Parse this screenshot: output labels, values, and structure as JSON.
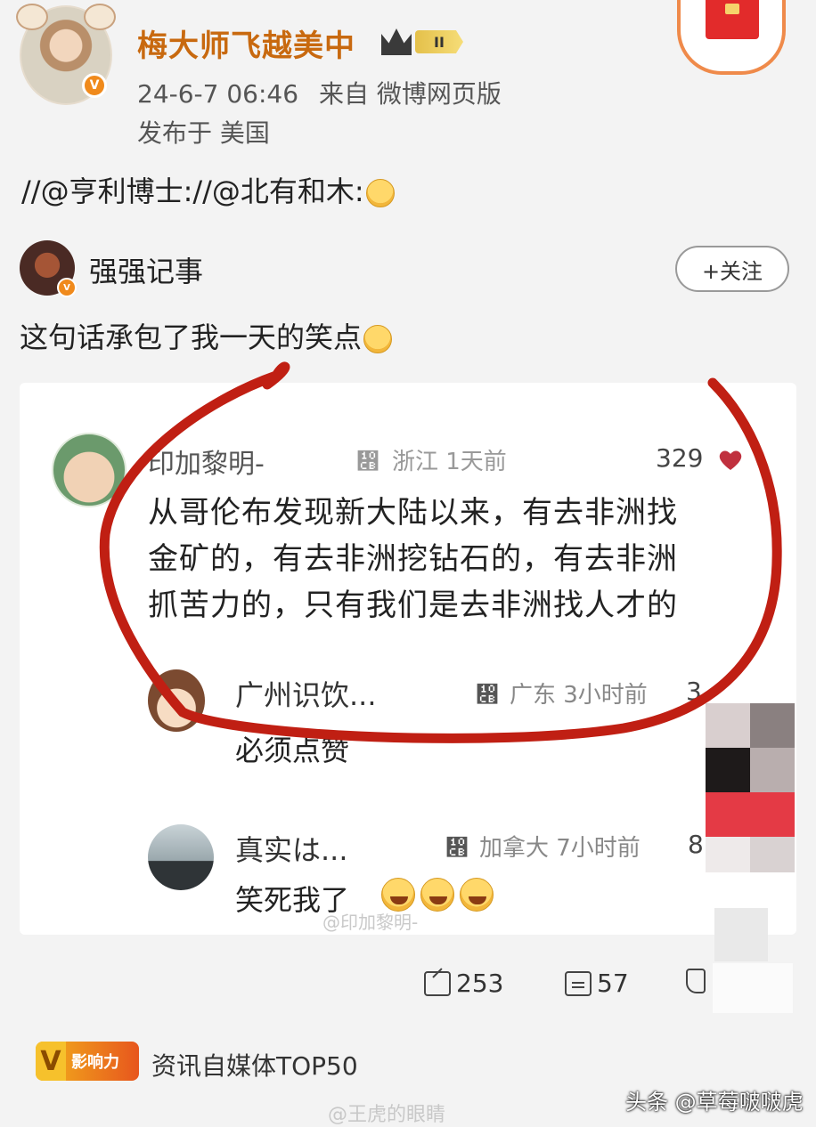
{
  "post": {
    "author_name": "梅大师飞越美中",
    "level": "II",
    "timestamp": "24-6-7 06:46",
    "source": "来自 微博网页版",
    "location": "发布于 美国",
    "repost_chain": "//@亨利博士://@北有和木:"
  },
  "quoted": {
    "author_name": "强强记事",
    "follow_label": "+关注",
    "text": "这句话承包了我一天的笑点"
  },
  "comments": [
    {
      "name": "印加黎明-",
      "location": "浙江 1天前",
      "likes": "329",
      "lines": [
        "从哥伦布发现新大陆以来，有去非洲找",
        "金矿的，有去非洲挖钻石的，有去非洲",
        "抓苦力的，只有我们是去非洲找人才的"
      ]
    },
    {
      "name": "广州识饮...",
      "location": "广东 3小时前",
      "likes": "3",
      "text": "必须点赞"
    },
    {
      "name": "真实は...",
      "location": "加拿大 7小时前",
      "likes": "8",
      "text": "笑死我了"
    }
  ],
  "actions": {
    "reposts": "253",
    "comments": "57"
  },
  "footer": {
    "badge_label": "影响力",
    "badge_letter": "V",
    "influence_text": "资讯自媒体TOP50",
    "watermark_card": "@印加黎明-",
    "watermark_bottom": "@王虎的眼睛",
    "toutiao": "头条 @草莓啵啵虎"
  },
  "colors": {
    "author": "#c8690f",
    "circle": "#c01f13",
    "heart": "#c0303e"
  },
  "icons": [
    "crown-icon",
    "heart-icon",
    "share-icon",
    "comment-icon",
    "like-icon",
    "emoji-icon",
    "red-envelope-icon"
  ]
}
